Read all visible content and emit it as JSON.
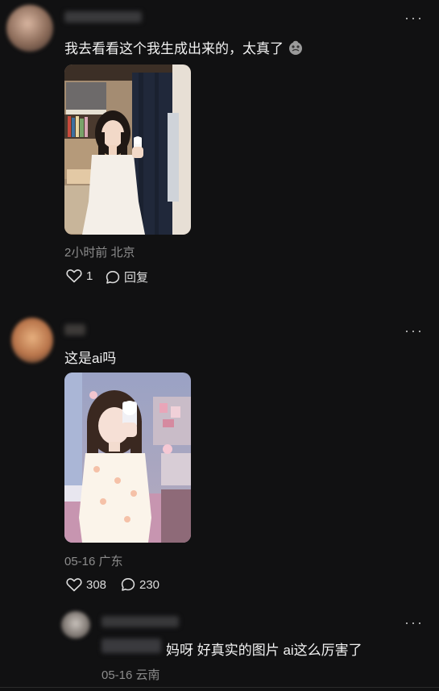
{
  "comments": [
    {
      "text": "我去看看这个我生成出来的，太真了",
      "meta": "2小时前 北京",
      "likes": "1",
      "reply_label": "回复"
    },
    {
      "text": "这是ai吗",
      "meta": "05-16 广东",
      "likes": "308",
      "replies": "230"
    },
    {
      "text": "妈呀 好真实的图片 ai这么厉害了",
      "meta": "05-16 云南"
    }
  ],
  "colors": {
    "background": "#111112",
    "text": "#f2f2f2",
    "meta": "#8c8c8c"
  }
}
